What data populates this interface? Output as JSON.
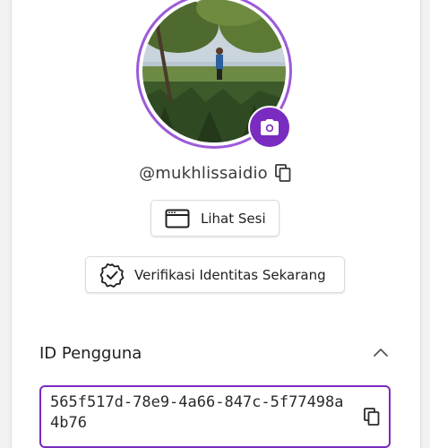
{
  "profile": {
    "username": "@mukhlissaidio",
    "avatar_alt": "profile photo"
  },
  "actions": {
    "session_label": "Lihat Sesi",
    "verify_label": "Verifikasi Identitas Sekarang"
  },
  "user_id": {
    "title": "ID Pengguna",
    "value": "565f517d-78e9-4a66-847c-5f77498a4b76"
  },
  "icons": {
    "camera": "camera-icon",
    "copy": "copy-icon",
    "session": "browser-window-icon",
    "verify": "verified-badge-icon",
    "collapse": "chevron-up-icon"
  },
  "colors": {
    "accent": "#7a2bc0",
    "ring": "#9c5ad8"
  }
}
